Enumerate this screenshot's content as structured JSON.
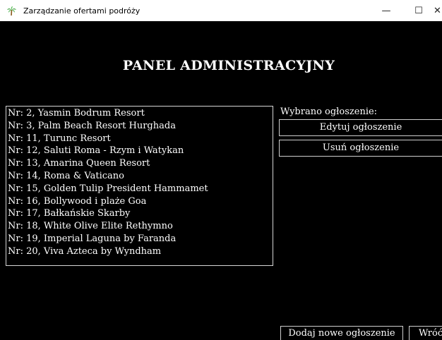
{
  "window": {
    "title": "Zarządzanie ofertami podróży",
    "controls": {
      "minimize": "—",
      "maximize": "☐",
      "close": "✕"
    }
  },
  "heading": "PANEL ADMINISTRACYJNY",
  "offers_list": {
    "items": [
      "Nr: 2, Yasmin Bodrum Resort",
      "Nr: 3, Palm Beach Resort Hurghada",
      "Nr: 11, Turunc Resort",
      "Nr: 12, Saluti Roma - Rzym i Watykan",
      "Nr: 13, Amarina Queen Resort",
      "Nr: 14, Roma & Vaticano",
      "Nr: 15, Golden Tulip President Hammamet",
      "Nr: 16, Bollywood i plaże Goa",
      "Nr: 17, Bałkańskie Skarby",
      "Nr: 18, White Olive Elite Rethymno",
      "Nr: 19, Imperial Laguna by Faranda",
      "Nr: 20, Viva Azteca by Wyndham"
    ]
  },
  "selection_panel": {
    "label": "Wybrano ogłoszenie:",
    "edit_button": "Edytuj ogłoszenie",
    "delete_button": "Usuń ogłoszenie"
  },
  "footer": {
    "add_button": "Dodaj nowe ogłoszenie",
    "back_button": "Wróć"
  }
}
